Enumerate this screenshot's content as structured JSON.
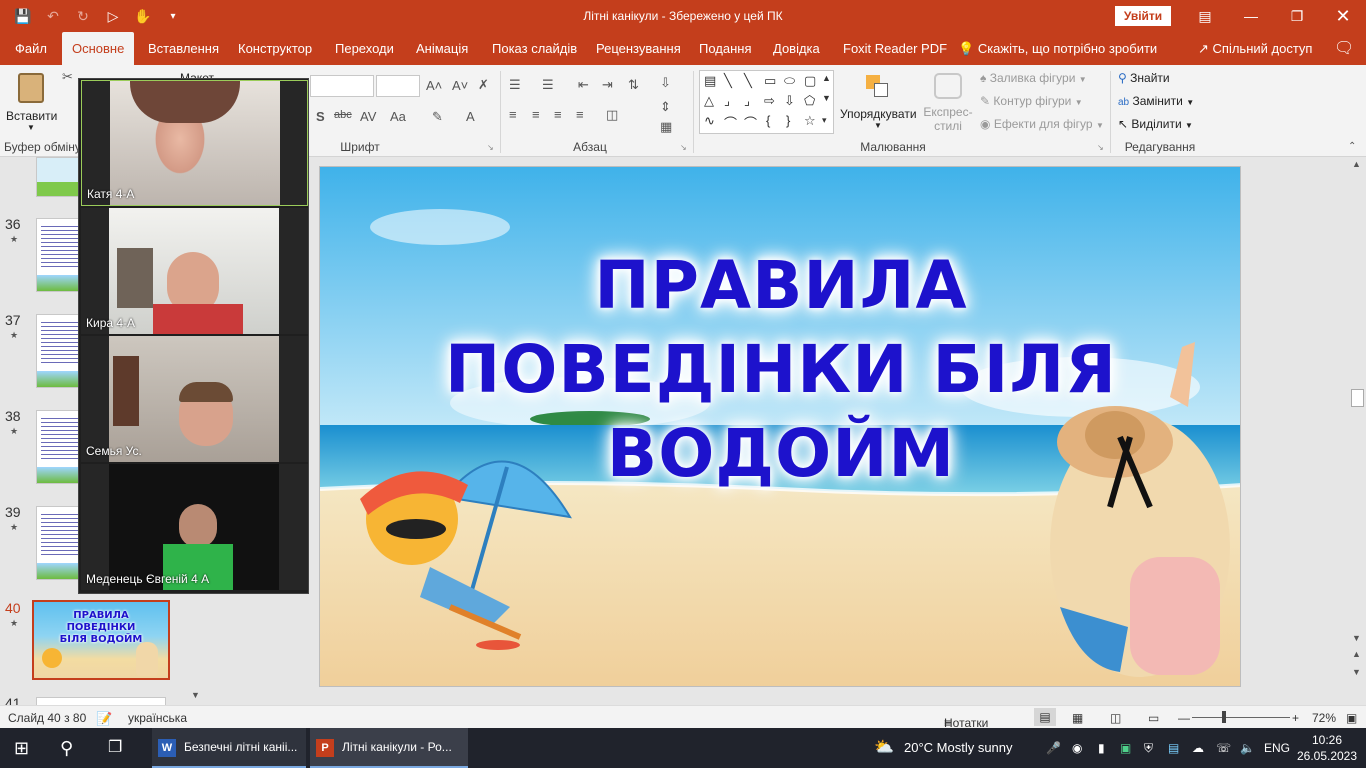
{
  "window": {
    "title": "Літні канікули  -  Збережено у цей ПК",
    "sign_in": "Увійти"
  },
  "tabs": [
    "Файл",
    "Основне",
    "Вставлення",
    "Конструктор",
    "Переходи",
    "Анімація",
    "Показ слайдів",
    "Рецензування",
    "Подання",
    "Довідка",
    "Foxit Reader PDF"
  ],
  "tell_me": "Скажіть, що потрібно зробити",
  "share": "Спільний доступ",
  "ribbon": {
    "paste": "Вставити",
    "clipboard_label": "Буфер обміну",
    "layout_partial": "Макет",
    "font_label": "Шрифт",
    "paragraph_label": "Абзац",
    "arrange": "Упорядкувати",
    "quick_styles": "Експрес-стилі",
    "shape_fill": "Заливка фігури",
    "shape_outline": "Контур фігури",
    "shape_effects": "Ефекти для фігур",
    "drawing_label": "Малювання",
    "find": "Знайти",
    "replace": "Замінити",
    "select": "Виділити",
    "editing_label": "Редагування"
  },
  "slides": [
    {
      "num": "36"
    },
    {
      "num": "37"
    },
    {
      "num": "38"
    },
    {
      "num": "39"
    },
    {
      "num": "40",
      "thumb_title": "ПРАВИЛА ПОВЕДІНКИ БІЛЯ ВОДОЙМ"
    },
    {
      "num": "41"
    }
  ],
  "participants": [
    {
      "name": "Катя  4-А"
    },
    {
      "name": "Кира 4-А"
    },
    {
      "name": "Семья Ус."
    },
    {
      "name": "Меденець Євгеній 4 А"
    }
  ],
  "slide": {
    "line1": "ПРАВИЛА",
    "line2": "ПОВЕДІНКИ БІЛЯ",
    "line3": "ВОДОЙМ"
  },
  "status": {
    "slide_info": "Слайд 40 з 80",
    "language": "українська",
    "notes": "Нотатки",
    "zoom": "72%"
  },
  "taskbar": {
    "app1": "Безпечні літні каніі...",
    "app2": "Літні канікули - Ро...",
    "weather": "20°C  Mostly sunny",
    "lang": "ENG",
    "time": "10:26",
    "date": "26.05.2023"
  },
  "colors": {
    "accent": "#c43e1c",
    "title_text": "#1d12cc",
    "taskbar": "#20232c"
  }
}
